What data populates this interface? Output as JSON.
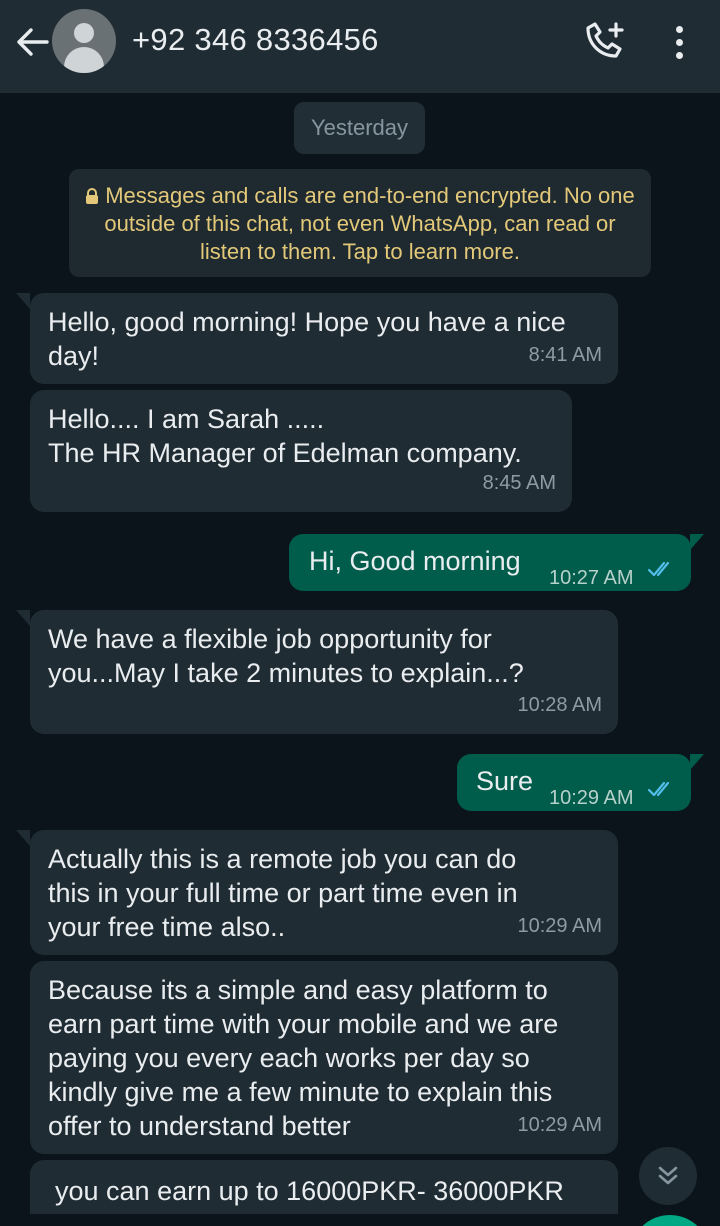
{
  "header": {
    "contact_name": "+92 346 8336456",
    "back_icon": "arrow-left-icon",
    "call_icon": "phone-add-icon",
    "menu_icon": "more-vertical-icon"
  },
  "chat": {
    "date_label": "Yesterday",
    "encryption_notice": "Messages and calls are end-to-end encrypted. No one outside of this chat, not even WhatsApp, can read or listen to them. Tap to learn more.",
    "messages": [
      {
        "direction": "in",
        "text": "Hello, good morning! Hope you have a nice\nday!",
        "time": "8:41 AM"
      },
      {
        "direction": "in",
        "text": "Hello.... I am Sarah .....\nThe HR Manager of Edelman company.",
        "time": "8:45 AM"
      },
      {
        "direction": "out",
        "text": "Hi, Good morning",
        "time": "10:27 AM",
        "status": "read"
      },
      {
        "direction": "in",
        "text": "We have a flexible job opportunity for\nyou...May I take 2 minutes to explain...?",
        "time": "10:28 AM"
      },
      {
        "direction": "out",
        "text": "Sure",
        "time": "10:29 AM",
        "status": "read"
      },
      {
        "direction": "in",
        "text": "Actually this is a remote job you can do\nthis in your full time or part time even in\nyour free time also..",
        "time": "10:29 AM"
      },
      {
        "direction": "in",
        "text": "Because its a simple and easy platform to\nearn part time with your mobile and we are\npaying you every each works per day so\nkindly give me a few minute to explain this\noffer to understand better",
        "time": "10:29 AM"
      },
      {
        "direction": "in",
        "text": "you can earn up to 16000PKR- 36000PKR",
        "time": ""
      }
    ]
  },
  "colors": {
    "background": "#0b141a",
    "header": "#1f2c34",
    "incoming_bubble": "#202c33",
    "outgoing_bubble": "#005c4b",
    "read_ticks": "#53bdeb",
    "encryption_text": "#e3c879"
  },
  "scroll_down_icon": "chevrons-down-icon"
}
